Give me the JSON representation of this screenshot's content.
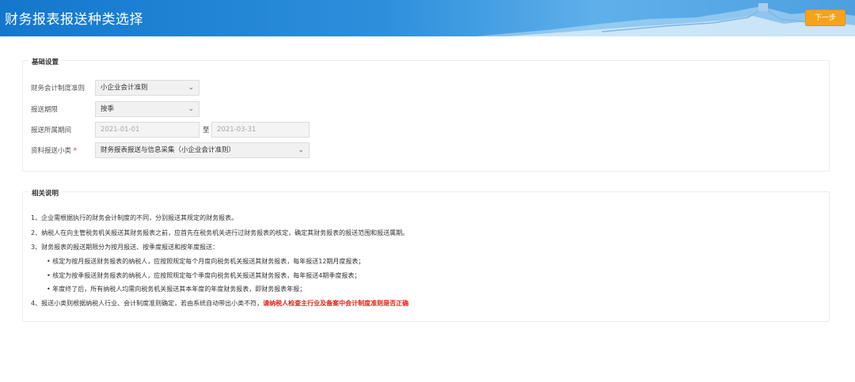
{
  "header": {
    "title": "财务报表报送种类选择",
    "next_label": "下一步"
  },
  "basic": {
    "title": "基础设置",
    "standard": {
      "label": "财务会计制度准则",
      "value": "小企业会计准则"
    },
    "period": {
      "label": "报送期限",
      "value": "按季"
    },
    "range": {
      "label": "报送所属期间",
      "start": "2021-01-01",
      "sep": "至",
      "end": "2021-03-31"
    },
    "category": {
      "label": "资料报送小类",
      "required": "*",
      "value": "财务报表报送与信息采集（小企业会计准则）"
    }
  },
  "notes": {
    "title": "相关说明",
    "n1": "1、企业需根据执行的财务会计制度的不同，分别报送其规定的财务报表。",
    "n2": "2、纳税人在向主管税务机关报送其财务报表之前，应首先在税务机关进行过财务报表的核定，确定其财务报表的报送范围和报送属期。",
    "n3": "3、财务报表的报送期限分为按月报送、按季度报送和按年度报送：",
    "b1": "• 核定为按月报送财务报表的纳税人，应按照规定每个月度向税务机关报送其财务报表，每年报送12期月度报表；",
    "b2": "• 核定为按季报送财务报表的纳税人，应按照规定每个季度向税务机关报送其财务报表，每年报送4期季度报表；",
    "b3": "• 年度终了后，所有纳税人均需向税务机关报送其本年度的年度财务报表，即财务报表年报；",
    "n4": "4、报送小类则根据纳税人行业、会计制度准则确定，若由系统自动带出小类不符，",
    "n4_warn": "请纳税人检查主行业及备案中会计制度准则是否正确"
  },
  "colors": {
    "header_blue": "#1477cc",
    "accent_orange": "#f7a21a",
    "required_red": "#e2231a"
  }
}
